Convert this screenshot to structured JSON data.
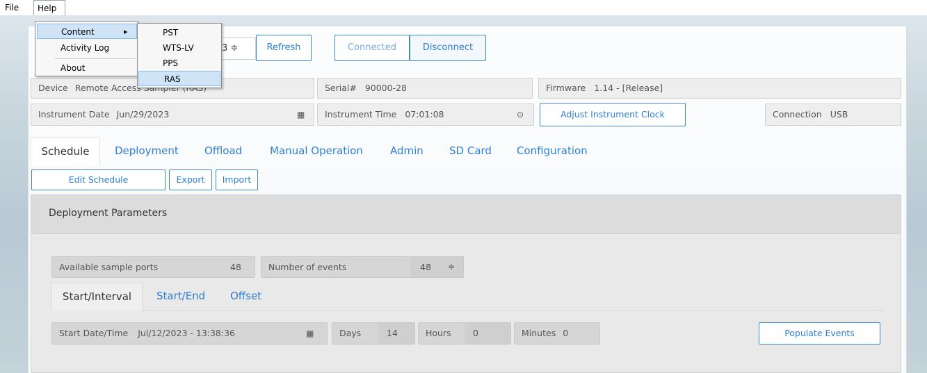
{
  "menubar": {
    "file": "File",
    "help": "Help"
  },
  "help_menu": {
    "items": [
      {
        "label": "Content",
        "arrow": "▸"
      },
      {
        "label": "Activity Log"
      },
      {
        "label": "About"
      }
    ],
    "content_submenu": [
      "PST",
      "WTS-LV",
      "PPS",
      "RAS"
    ]
  },
  "connection_bar": {
    "port_partial": "3 ≑",
    "refresh": "Refresh",
    "connected": "Connected",
    "disconnect": "Disconnect"
  },
  "device_info": {
    "device_label": "Device",
    "device_value": "Remote Access Sampler (RAS)",
    "serial_label": "Serial#",
    "serial_value": "90000-28",
    "firmware_label": "Firmware",
    "firmware_value": "1.14 - [Release]",
    "instrument_date_label": "Instrument Date",
    "instrument_date_value": "Jun/29/2023",
    "instrument_time_label": "Instrument Time",
    "instrument_time_value": "07:01:08",
    "adjust_clock": "Adjust Instrument Clock",
    "connection_label": "Connection",
    "connection_value": "USB"
  },
  "main_tabs": [
    "Schedule",
    "Deployment",
    "Offload",
    "Manual Operation",
    "Admin",
    "SD Card",
    "Configuration"
  ],
  "schedule_buttons": {
    "edit": "Edit Schedule",
    "export": "Export",
    "import": "Import"
  },
  "deployment_params": {
    "title": "Deployment Parameters",
    "available_ports_label": "Available sample ports",
    "available_ports_value": "48",
    "num_events_label": "Number of events",
    "num_events_value": "48",
    "spinner": "≑",
    "sub_tabs": [
      "Start/Interval",
      "Start/End",
      "Offset"
    ],
    "start_label": "Start Date/Time",
    "start_value": "Jul/12/2023 - 13:38:36",
    "days_label": "Days",
    "days_value": "14",
    "hours_label": "Hours",
    "hours_value": "0",
    "minutes_label": "Minutes",
    "minutes_value": "0",
    "populate": "Populate Events"
  },
  "icons": {
    "calendar": "calendar-icon",
    "clock": "clock-icon",
    "submenu_arrow": "chevron-right-icon"
  }
}
